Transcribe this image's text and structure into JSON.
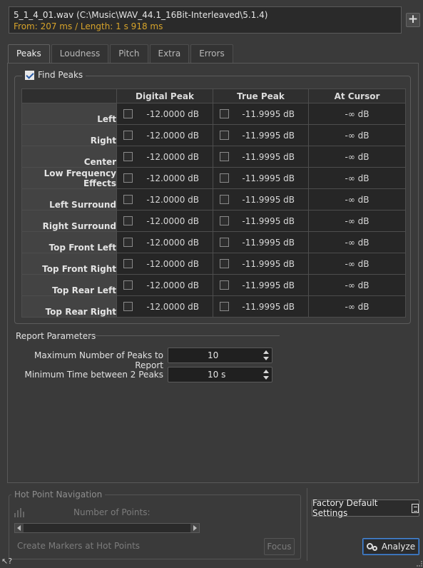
{
  "file": {
    "name": "5_1_4_01.wav (C:\\Music\\WAV_44.1_16Bit-Interleaved\\5.1.4)",
    "range": "From: 207 ms / Length: 1 s 918 ms",
    "add_label": "+"
  },
  "tabs": [
    {
      "label": "Peaks",
      "active": true
    },
    {
      "label": "Loudness",
      "active": false
    },
    {
      "label": "Pitch",
      "active": false
    },
    {
      "label": "Extra",
      "active": false
    },
    {
      "label": "Errors",
      "active": false
    }
  ],
  "find_peaks": {
    "label": "Find Peaks",
    "checked": true,
    "columns": [
      "Digital Peak",
      "True Peak",
      "At Cursor"
    ],
    "rows": [
      {
        "channel": "Left",
        "digital": "-12.0000 dB",
        "true_peak": "-11.9995 dB",
        "cursor": "-∞ dB"
      },
      {
        "channel": "Right",
        "digital": "-12.0000 dB",
        "true_peak": "-11.9995 dB",
        "cursor": "-∞ dB"
      },
      {
        "channel": "Center",
        "digital": "-12.0000 dB",
        "true_peak": "-11.9995 dB",
        "cursor": "-∞ dB"
      },
      {
        "channel": "Low Frequency Effects",
        "digital": "-12.0000 dB",
        "true_peak": "-11.9995 dB",
        "cursor": "-∞ dB"
      },
      {
        "channel": "Left Surround",
        "digital": "-12.0000 dB",
        "true_peak": "-11.9995 dB",
        "cursor": "-∞ dB"
      },
      {
        "channel": "Right Surround",
        "digital": "-12.0000 dB",
        "true_peak": "-11.9995 dB",
        "cursor": "-∞ dB"
      },
      {
        "channel": "Top Front Left",
        "digital": "-12.0000 dB",
        "true_peak": "-11.9995 dB",
        "cursor": "-∞ dB"
      },
      {
        "channel": "Top Front Right",
        "digital": "-12.0000 dB",
        "true_peak": "-11.9995 dB",
        "cursor": "-∞ dB"
      },
      {
        "channel": "Top Rear Left",
        "digital": "-12.0000 dB",
        "true_peak": "-11.9995 dB",
        "cursor": "-∞ dB"
      },
      {
        "channel": "Top Rear Right",
        "digital": "-12.0000 dB",
        "true_peak": "-11.9995 dB",
        "cursor": "-∞ dB"
      }
    ]
  },
  "report": {
    "title": "Report Parameters",
    "max_peaks_label": "Maximum Number of Peaks to Report",
    "max_peaks_value": "10",
    "min_time_label": "Minimum Time between 2 Peaks",
    "min_time_value": "10 s"
  },
  "hot_point": {
    "title": "Hot Point Navigation",
    "points_label": "Number of Points:",
    "markers_label": "Create Markers at Hot Points",
    "focus_label": "Focus"
  },
  "buttons": {
    "factory_label": "Factory Default Settings",
    "analyze_label": "Analyze"
  },
  "icons": {
    "add": "plus-icon",
    "doc": "document-icon",
    "gear": "gear-icon",
    "help": "help-cursor-icon"
  },
  "help_label": "?"
}
